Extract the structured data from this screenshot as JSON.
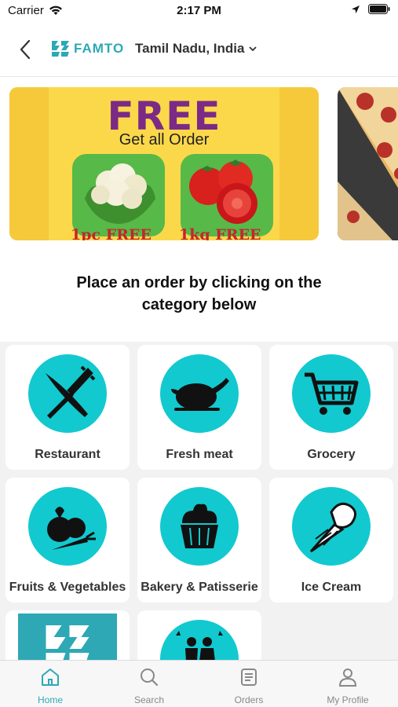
{
  "status": {
    "carrier": "Carrier",
    "time": "2:17 PM"
  },
  "header": {
    "logo_text": "FAMTO",
    "location": "Tamil Nadu, India"
  },
  "banner": {
    "headline": "FREE",
    "subtitle": "Get all Order",
    "label_left": "1pc FREE",
    "label_right": "1kg FREE"
  },
  "prompt": "Place an order by clicking on the category below",
  "categories": [
    {
      "label": "Restaurant",
      "icon": "fork-knife-icon"
    },
    {
      "label": "Fresh meat",
      "icon": "roast-chicken-icon"
    },
    {
      "label": "Grocery",
      "icon": "shopping-cart-icon"
    },
    {
      "label": "Fruits & Vegetables",
      "icon": "vegetables-icon"
    },
    {
      "label": "Bakery & Patisserie",
      "icon": "cupcake-icon"
    },
    {
      "label": "Ice Cream",
      "icon": "ice-cream-icon"
    },
    {
      "label": "",
      "icon": "famto-logo-icon"
    },
    {
      "label": "",
      "icon": "wedding-couple-icon"
    }
  ],
  "tabs": [
    {
      "label": "Home",
      "icon": "home-icon",
      "active": true
    },
    {
      "label": "Search",
      "icon": "search-icon",
      "active": false
    },
    {
      "label": "Orders",
      "icon": "orders-icon",
      "active": false
    },
    {
      "label": "My Profile",
      "icon": "profile-icon",
      "active": false
    }
  ],
  "colors": {
    "accent": "#2ea8b5",
    "category_circle": "#12c9cf",
    "banner_yellow": "#f5c93a",
    "banner_purple": "#7b2a86"
  }
}
